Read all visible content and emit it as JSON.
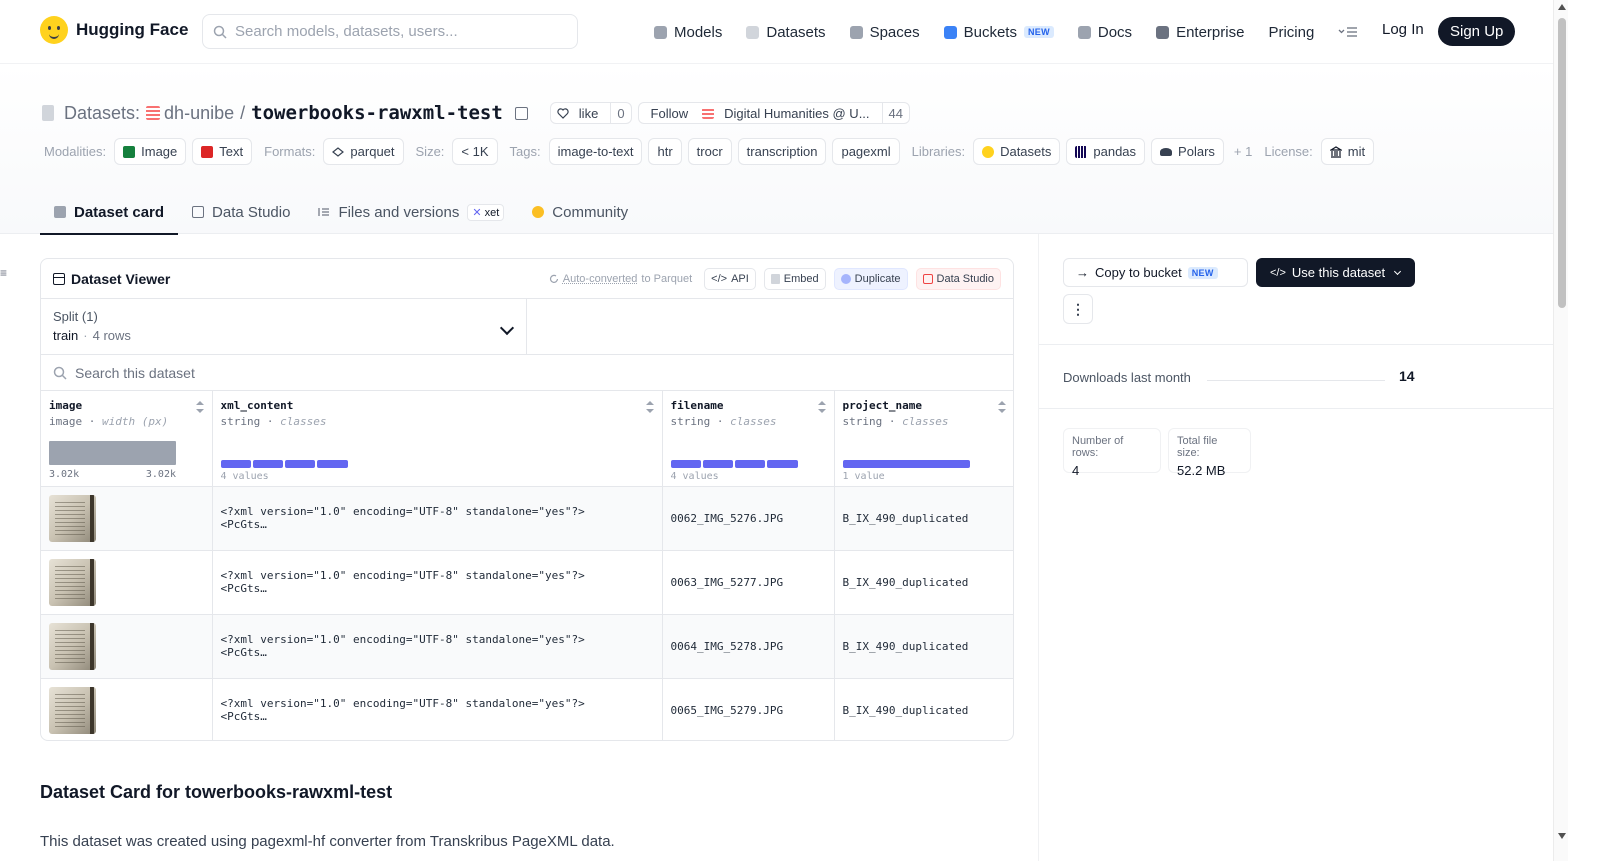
{
  "nav": {
    "brand": "Hugging Face",
    "search_placeholder": "Search models, datasets, users...",
    "links": [
      {
        "label": "Models",
        "icon": "models-icon",
        "color": "#9ca3af"
      },
      {
        "label": "Datasets",
        "icon": "datasets-icon",
        "color": "#d1d5db"
      },
      {
        "label": "Spaces",
        "icon": "spaces-icon",
        "color": "#9ca3af"
      },
      {
        "label": "Buckets",
        "icon": "buckets-icon",
        "color": "#3b82f6",
        "badge": "NEW"
      },
      {
        "label": "Docs",
        "icon": "docs-icon",
        "color": "#9ca3af"
      },
      {
        "label": "Enterprise",
        "icon": "enterprise-icon",
        "color": "#6b7280"
      },
      {
        "label": "Pricing"
      }
    ],
    "login": "Log In",
    "signup": "Sign Up"
  },
  "header": {
    "section": "Datasets:",
    "org": "dh-unibe",
    "separator": "/",
    "name": "towerbooks-rawxml-test",
    "like_label": "like",
    "like_count": "0",
    "follow_label": "Follow",
    "follow_org": "Digital Humanities @ U...",
    "follow_count": "44"
  },
  "meta": {
    "modalities_label": "Modalities:",
    "modalities": [
      {
        "label": "Image",
        "color": "#15803d"
      },
      {
        "label": "Text",
        "color": "#dc2626"
      }
    ],
    "formats_label": "Formats:",
    "formats": [
      "parquet"
    ],
    "size_label": "Size:",
    "size": "< 1K",
    "tags_label": "Tags:",
    "tags": [
      "image-to-text",
      "htr",
      "trocr",
      "transcription",
      "pagexml"
    ],
    "libraries_label": "Libraries:",
    "libraries": [
      "Datasets",
      "pandas",
      "Polars"
    ],
    "libraries_more": "+ 1",
    "license_label": "License:",
    "license": "mit"
  },
  "tabs": [
    {
      "label": "Dataset card",
      "active": true
    },
    {
      "label": "Data Studio"
    },
    {
      "label": "Files and versions",
      "badge": "xet"
    },
    {
      "label": "Community"
    }
  ],
  "viewer": {
    "title": "Dataset Viewer",
    "auto_converted": "Auto-converted",
    "to_parquet": "to Parquet",
    "actions": [
      "API",
      "Embed",
      "Duplicate",
      "Data Studio"
    ],
    "split_label": "Split (1)",
    "split_value": "train",
    "split_rows": "4 rows",
    "search_placeholder": "Search this dataset",
    "columns": [
      {
        "name": "image",
        "type": "image",
        "detail": "width (px)",
        "range_min": "3.02k",
        "range_max": "3.02k"
      },
      {
        "name": "xml_content",
        "type": "string",
        "detail": "classes",
        "count": "4 values"
      },
      {
        "name": "filename",
        "type": "string",
        "detail": "classes",
        "count": "4 values"
      },
      {
        "name": "project_name",
        "type": "string",
        "detail": "classes",
        "count": "1 value"
      }
    ],
    "rows": [
      {
        "xml1": "<?xml version=\"1.0\" encoding=\"UTF-8\" standalone=\"yes\"?>",
        "xml2": "<PcGts…",
        "filename": "0062_IMG_5276.JPG",
        "project": "B_IX_490_duplicated"
      },
      {
        "xml1": "<?xml version=\"1.0\" encoding=\"UTF-8\" standalone=\"yes\"?>",
        "xml2": "<PcGts…",
        "filename": "0063_IMG_5277.JPG",
        "project": "B_IX_490_duplicated"
      },
      {
        "xml1": "<?xml version=\"1.0\" encoding=\"UTF-8\" standalone=\"yes\"?>",
        "xml2": "<PcGts…",
        "filename": "0064_IMG_5278.JPG",
        "project": "B_IX_490_duplicated"
      },
      {
        "xml1": "<?xml version=\"1.0\" encoding=\"UTF-8\" standalone=\"yes\"?>",
        "xml2": "<PcGts…",
        "filename": "0065_IMG_5279.JPG",
        "project": "B_IX_490_duplicated"
      }
    ]
  },
  "card": {
    "title": "Dataset Card for towerbooks-rawxml-test",
    "text": "This dataset was created using pagexml-hf converter from Transkribus PageXML data."
  },
  "sidebar": {
    "copy_bucket": "Copy to bucket",
    "copy_bucket_badge": "NEW",
    "use_dataset": "Use this dataset",
    "downloads_label": "Downloads last month",
    "downloads_value": "14",
    "rows_label": "Number of rows:",
    "rows_value": "4",
    "size_label": "Total file size:",
    "size_value": "52.2 MB"
  }
}
